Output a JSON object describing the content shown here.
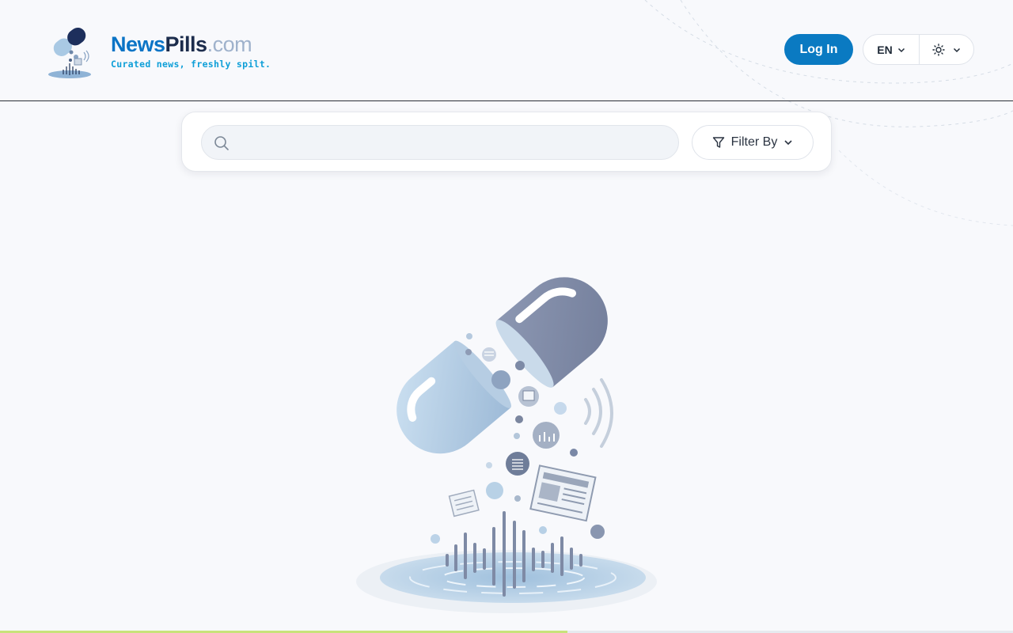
{
  "brand": {
    "name_part1": "News",
    "name_part2": "Pills",
    "name_tld": ".com",
    "tagline": "Curated news, freshly spilt."
  },
  "header": {
    "login_label": "Log In",
    "language": "EN",
    "theme_icon": "sun-icon"
  },
  "search": {
    "placeholder": "",
    "value": "",
    "filter_label": "Filter By"
  },
  "colors": {
    "brand_blue": "#0a7ac2",
    "brand_navy": "#1c2c4c",
    "tagline_cyan": "#0e9fd8",
    "page_bg": "#f8f9fc",
    "loading_bar": "#c8e27a"
  },
  "loading": {
    "progress_fraction": 0.56
  }
}
